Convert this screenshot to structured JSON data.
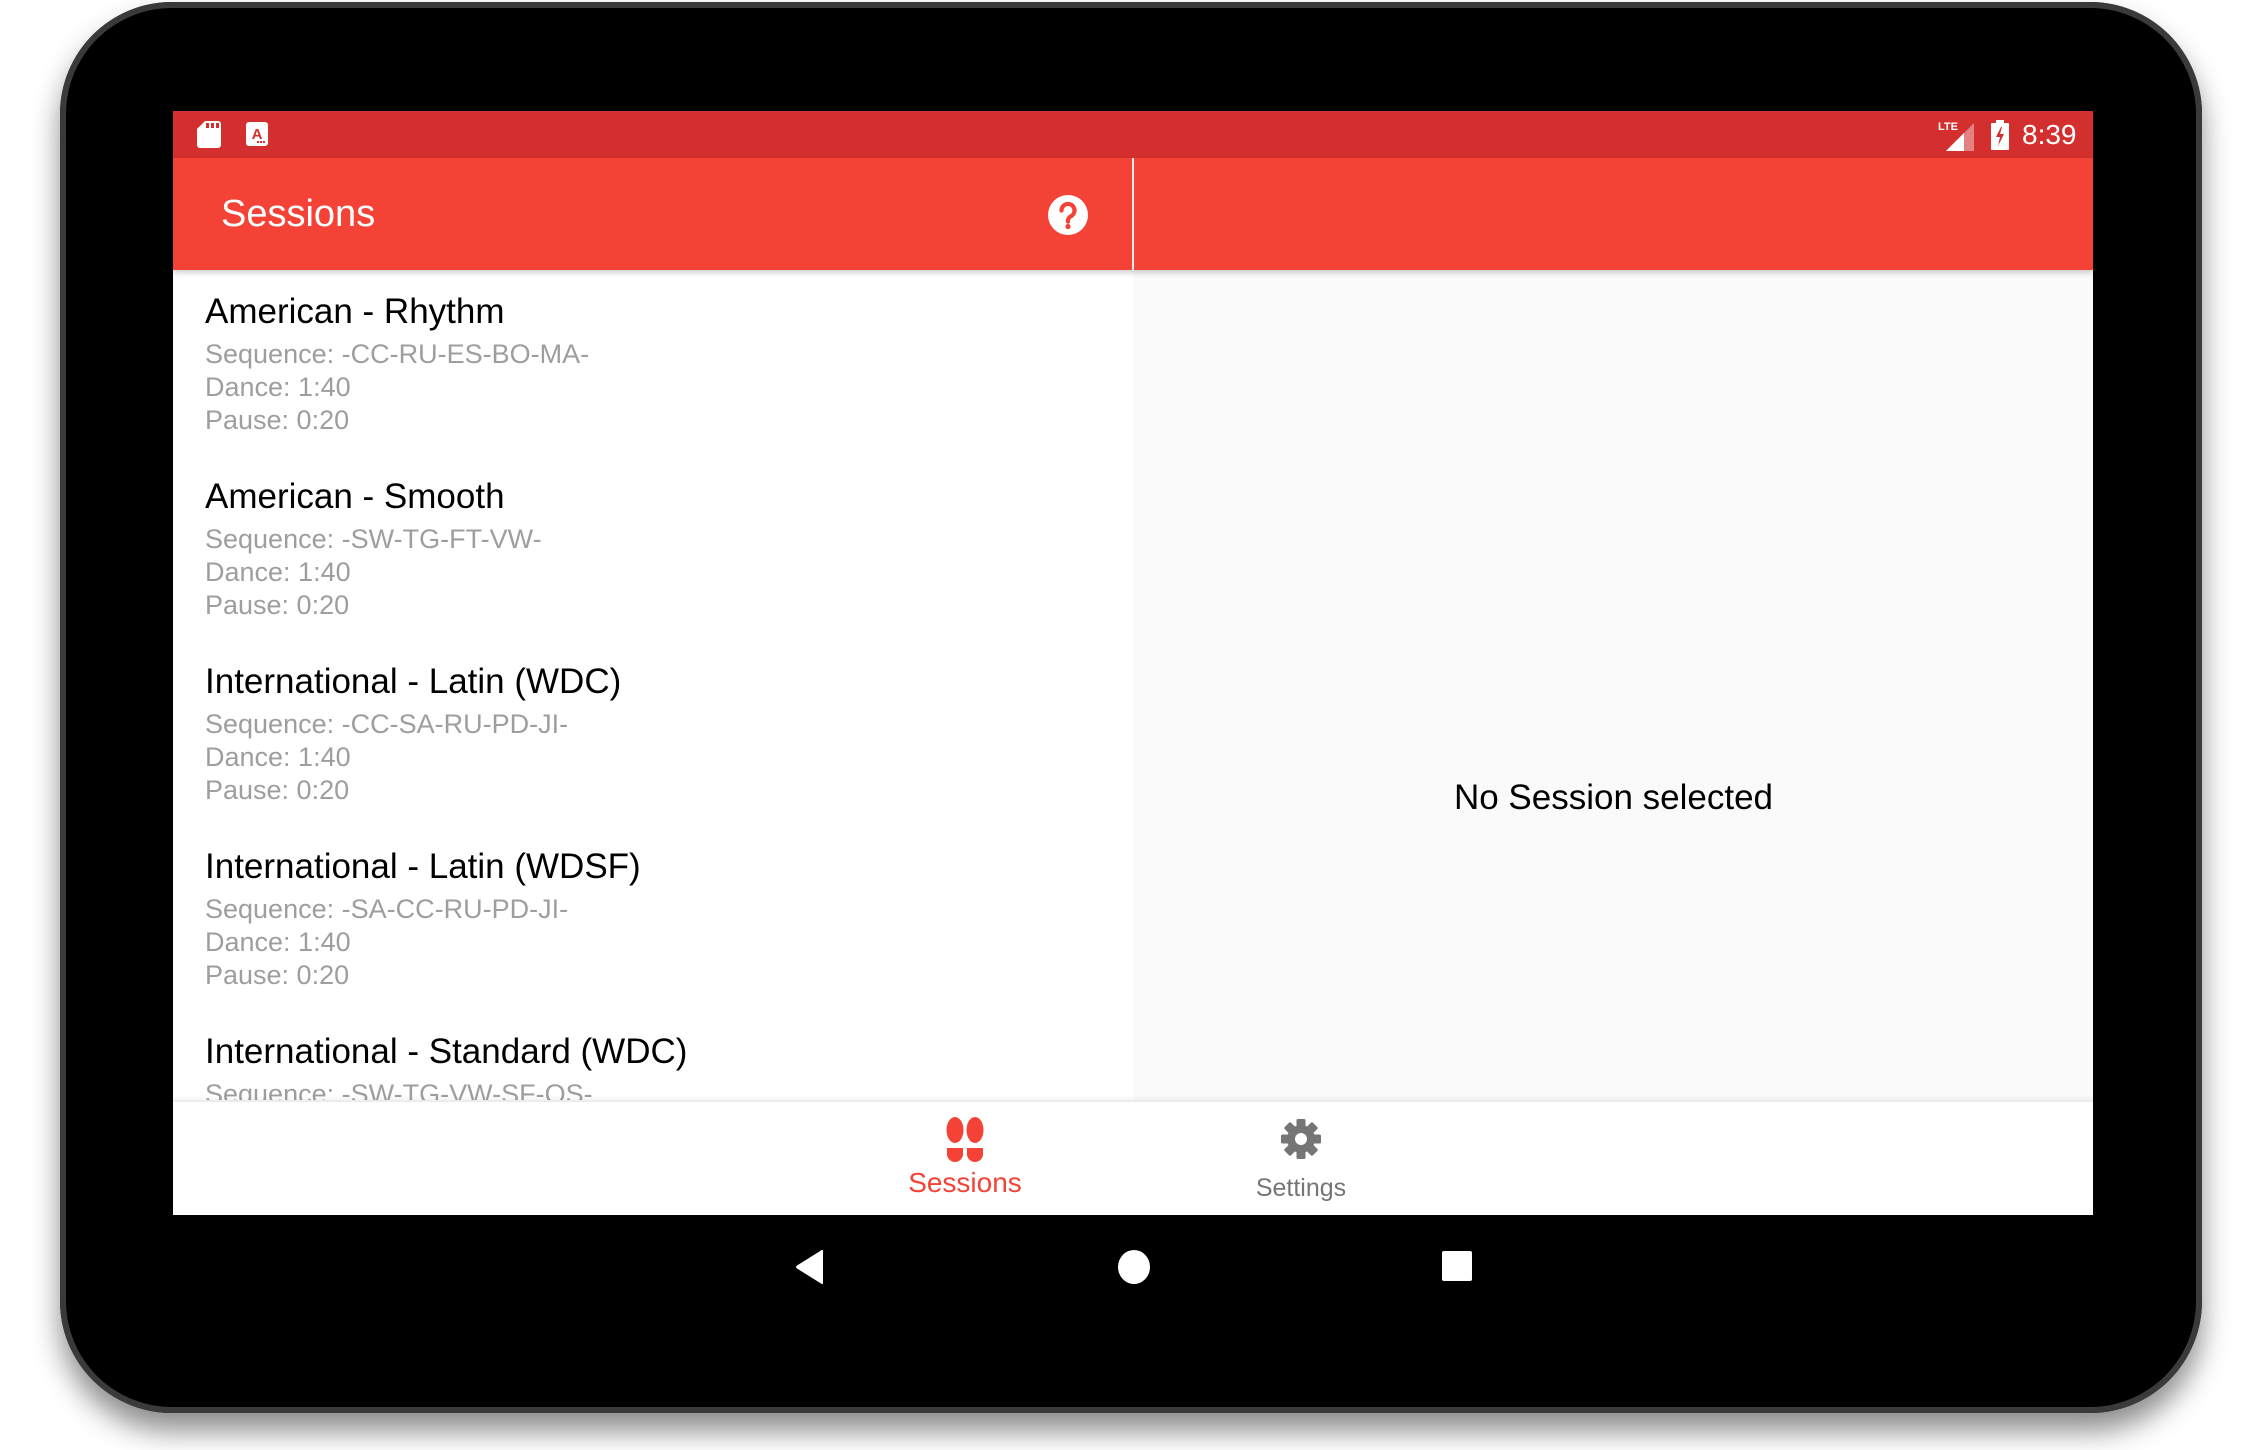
{
  "status_bar": {
    "left_icons": [
      "sd-card-icon",
      "a-notification-icon"
    ],
    "network": "LTE",
    "battery": "charging",
    "time": "8:39"
  },
  "app_bar": {
    "title": "Sessions",
    "help_icon": "help-circle-icon"
  },
  "sessions": [
    {
      "title": "American - Rhythm",
      "sequence": "Sequence: -CC-RU-ES-BO-MA-",
      "dance": "Dance: 1:40",
      "pause": "Pause: 0:20"
    },
    {
      "title": "American - Smooth",
      "sequence": "Sequence: -SW-TG-FT-VW-",
      "dance": "Dance: 1:40",
      "pause": "Pause: 0:20"
    },
    {
      "title": "International - Latin (WDC)",
      "sequence": "Sequence: -CC-SA-RU-PD-JI-",
      "dance": "Dance: 1:40",
      "pause": "Pause: 0:20"
    },
    {
      "title": "International - Latin (WDSF)",
      "sequence": "Sequence: -SA-CC-RU-PD-JI-",
      "dance": "Dance: 1:40",
      "pause": "Pause: 0:20"
    },
    {
      "title": "International - Standard (WDC)",
      "sequence": "Sequence: -SW-TG-VW-SF-QS-",
      "dance": "",
      "pause": ""
    }
  ],
  "detail": {
    "empty_text": "No Session selected"
  },
  "bottom_nav": {
    "tabs": [
      {
        "label": "Sessions",
        "icon": "footprints-icon",
        "active": true
      },
      {
        "label": "Settings",
        "icon": "gear-icon",
        "active": false
      }
    ]
  },
  "system_nav": [
    "back",
    "home",
    "recents"
  ],
  "colors": {
    "status_bar": "#D32F2F",
    "primary": "#F44336",
    "active_tab": "#F44336",
    "inactive_tab": "#757575",
    "secondary_text": "#9E9E9E",
    "detail_background": "#FAFAFA"
  }
}
